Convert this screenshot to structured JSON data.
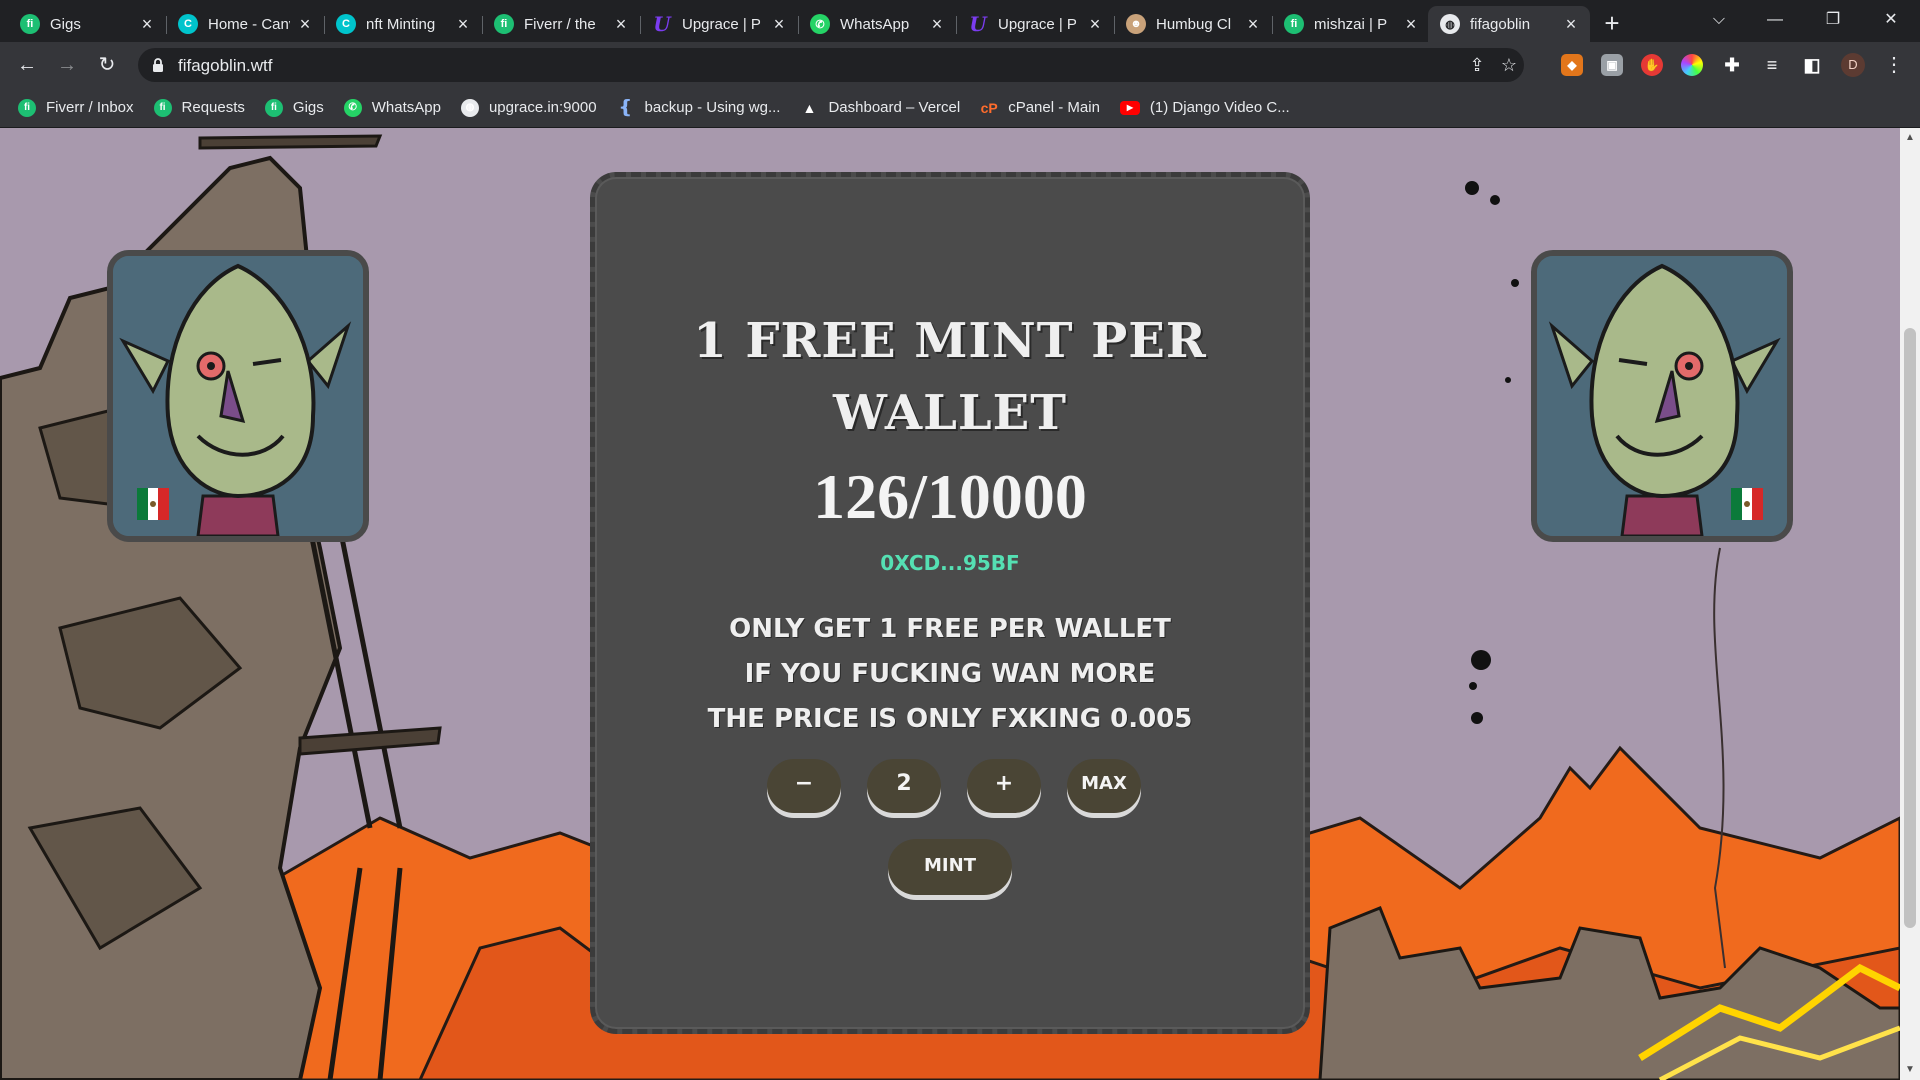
{
  "browser": {
    "tabs": [
      {
        "title": "Gigs",
        "favicon": "fiverr-icon",
        "active": false
      },
      {
        "title": "Home - Canva",
        "favicon": "canva-icon",
        "active": false
      },
      {
        "title": "nft Minting",
        "favicon": "canva-icon",
        "active": false
      },
      {
        "title": "Fiverr / the",
        "favicon": "fiverr-icon",
        "active": false
      },
      {
        "title": "Upgrace | P",
        "favicon": "upgrace-icon",
        "active": false
      },
      {
        "title": "WhatsApp",
        "favicon": "whatsapp-icon",
        "active": false
      },
      {
        "title": "Upgrace | P",
        "favicon": "upgrace-icon",
        "active": false
      },
      {
        "title": "Humbug Cl",
        "favicon": "humbug-icon",
        "active": false
      },
      {
        "title": "mishzai | P",
        "favicon": "fiverr-icon",
        "active": false
      },
      {
        "title": "fifagoblin",
        "favicon": "globe-icon",
        "active": true
      }
    ],
    "url": "fifagoblin.wtf",
    "profile_initial": "D",
    "bookmarks": [
      {
        "label": "Fiverr / Inbox",
        "favicon": "fiverr-icon"
      },
      {
        "label": "Requests",
        "favicon": "fiverr-icon"
      },
      {
        "label": "Gigs",
        "favicon": "fiverr-icon"
      },
      {
        "label": "WhatsApp",
        "favicon": "whatsapp-icon"
      },
      {
        "label": "upgrace.in:9000",
        "favicon": "globe-icon"
      },
      {
        "label": "backup - Using wg...",
        "favicon": "bitbucket-icon"
      },
      {
        "label": "Dashboard – Vercel",
        "favicon": "vercel-icon"
      },
      {
        "label": "cPanel - Main",
        "favicon": "cpanel-icon"
      },
      {
        "label": "(1) Django Video C...",
        "favicon": "youtube-icon"
      }
    ]
  },
  "mint": {
    "headline_line1": "1 Free Mint per",
    "headline_line2": "wallet",
    "minted": "126/10000",
    "wallet": "0XCD...95BF",
    "info_line1": "only get 1 free per wallet",
    "info_line2": "if you fucking wan more",
    "info_line3": "the price is only fxking 0.005",
    "decrement_label": "−",
    "quantity": "2",
    "increment_label": "+",
    "max_label": "MAX",
    "mint_label": "MINT"
  },
  "colors": {
    "panel_bg": "#4b4b4b",
    "wallet_text": "#55e0b3",
    "button_bg": "#4a4535",
    "sky": "#a899ad",
    "lava": "#f06a1e"
  }
}
